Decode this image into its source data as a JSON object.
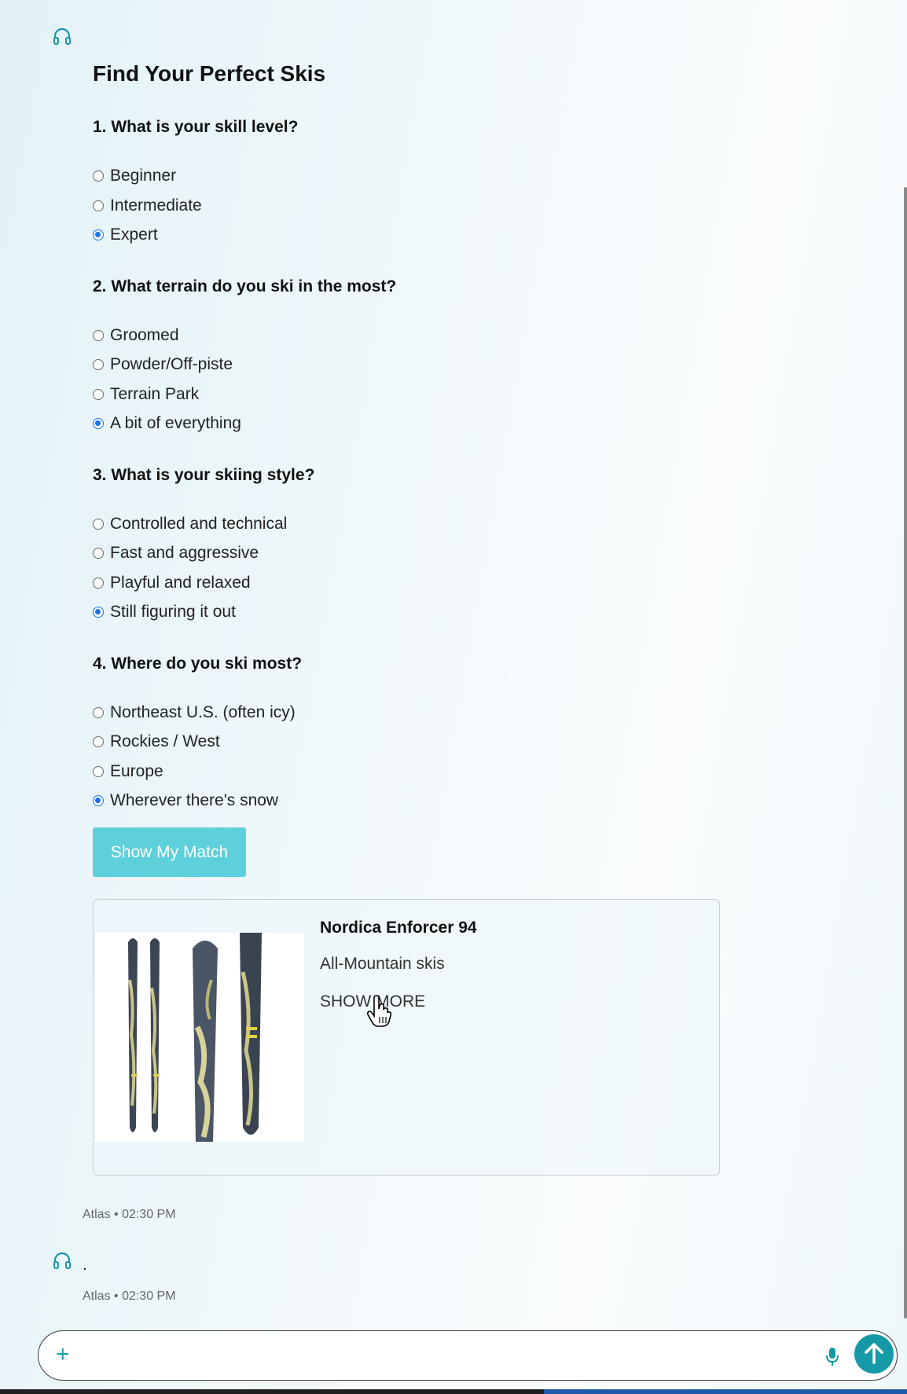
{
  "quiz": {
    "title": "Find Your Perfect Skis",
    "questions": [
      {
        "label": "1. What is your skill level?",
        "options": [
          {
            "label": "Beginner",
            "checked": false
          },
          {
            "label": "Intermediate",
            "checked": false
          },
          {
            "label": "Expert",
            "checked": true
          }
        ]
      },
      {
        "label": "2. What terrain do you ski in the most?",
        "options": [
          {
            "label": "Groomed",
            "checked": false
          },
          {
            "label": "Powder/Off-piste",
            "checked": false
          },
          {
            "label": "Terrain Park",
            "checked": false
          },
          {
            "label": "A bit of everything",
            "checked": true
          }
        ]
      },
      {
        "label": "3. What is your skiing style?",
        "options": [
          {
            "label": "Controlled and technical",
            "checked": false
          },
          {
            "label": "Fast and aggressive",
            "checked": false
          },
          {
            "label": "Playful and relaxed",
            "checked": false
          },
          {
            "label": "Still figuring it out",
            "checked": true
          }
        ]
      },
      {
        "label": "4. Where do you ski most?",
        "options": [
          {
            "label": "Northeast U.S. (often icy)",
            "checked": false
          },
          {
            "label": "Rockies / West",
            "checked": false
          },
          {
            "label": "Europe",
            "checked": false
          },
          {
            "label": "Wherever there's snow",
            "checked": true
          }
        ]
      }
    ],
    "submit_label": "Show My Match"
  },
  "product": {
    "name": "Nordica Enforcer 94",
    "category": "All-Mountain skis",
    "show_more_label": "SHOW MORE"
  },
  "messages": [
    {
      "sender": "Atlas",
      "time": "02:30 PM",
      "meta": "Atlas • 02:30 PM"
    },
    {
      "sender": "Atlas",
      "time": "02:30 PM",
      "text": ".",
      "meta": "Atlas • 02:30 PM"
    }
  ],
  "composer": {
    "placeholder": "",
    "value": ""
  },
  "colors": {
    "accent": "#5ed0db",
    "send": "#1699a6",
    "radio_checked": "#1a73e8"
  },
  "icons": [
    "headset-icon",
    "plus-icon",
    "mic-icon",
    "arrow-up-icon",
    "hand-cursor-icon"
  ]
}
